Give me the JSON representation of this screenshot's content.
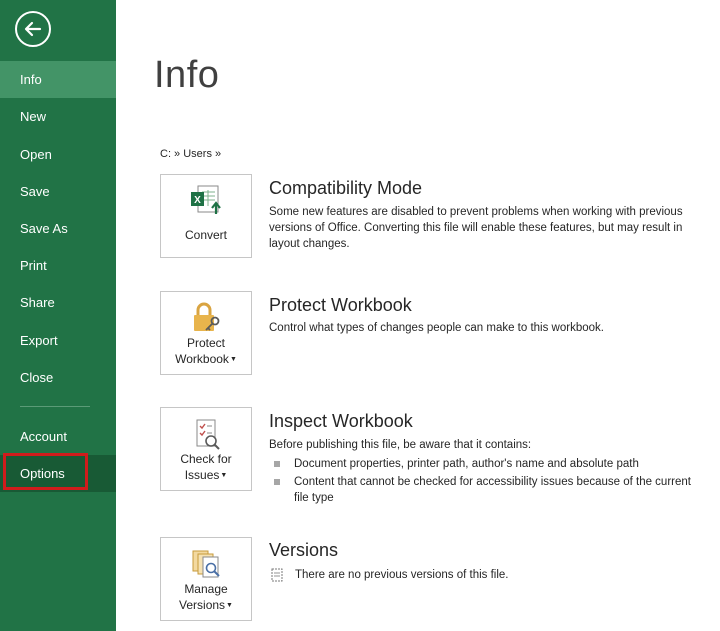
{
  "sidebar": {
    "items": [
      {
        "label": "Info"
      },
      {
        "label": "New"
      },
      {
        "label": "Open"
      },
      {
        "label": "Save"
      },
      {
        "label": "Save As"
      },
      {
        "label": "Print"
      },
      {
        "label": "Share"
      },
      {
        "label": "Export"
      },
      {
        "label": "Close"
      },
      {
        "label": "Account"
      },
      {
        "label": "Options"
      }
    ]
  },
  "main": {
    "title": "Info",
    "breadcrumb": "C: » Users »",
    "sections": [
      {
        "button_label": "Convert",
        "title": "Compatibility Mode",
        "description": "Some new features are disabled to prevent problems when working with previous versions of Office. Converting this file will enable these features, but may result in layout changes."
      },
      {
        "button_line1": "Protect",
        "button_line2": "Workbook",
        "title": "Protect Workbook",
        "description": "Control what types of changes people can make to this workbook."
      },
      {
        "button_line1": "Check for",
        "button_line2": "Issues",
        "title": "Inspect Workbook",
        "description": "Before publishing this file, be aware that it contains:",
        "bullets": [
          "Document properties, printer path, author's name and absolute path",
          "Content that cannot be checked for accessibility issues because of the current file type"
        ]
      },
      {
        "button_line1": "Manage",
        "button_line2": "Versions",
        "title": "Versions",
        "description": "There are no previous versions of this file."
      }
    ]
  },
  "colors": {
    "sidebar_bg": "#217346",
    "sidebar_active": "#439467",
    "highlight_border": "#d01c1c"
  }
}
